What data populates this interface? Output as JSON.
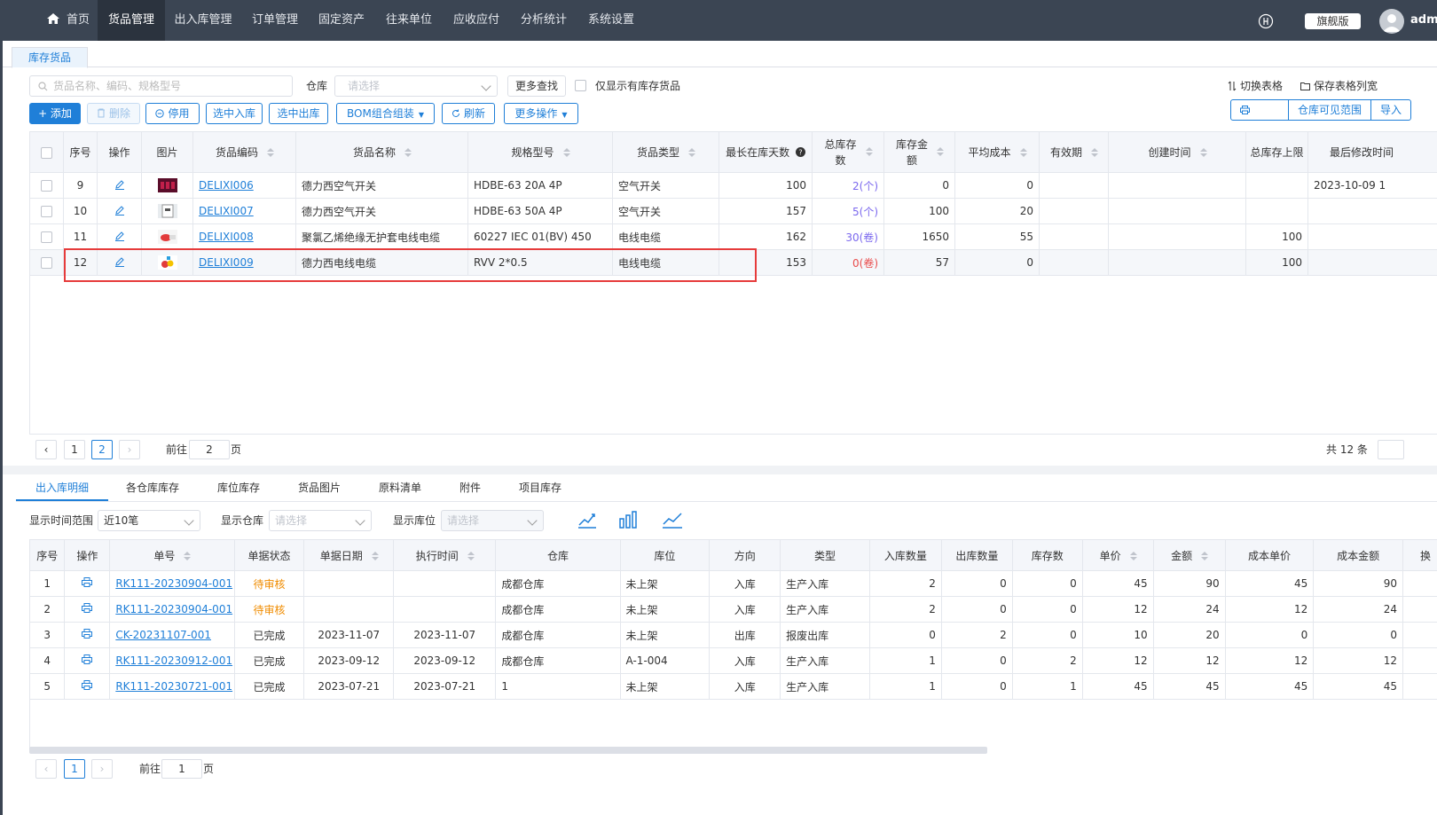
{
  "nav": {
    "items": [
      "首页",
      "货品管理",
      "出入库管理",
      "订单管理",
      "固定资产",
      "往来单位",
      "应收应付",
      "分析统计",
      "系统设置"
    ],
    "edition": "旗舰版",
    "user": "admi"
  },
  "page_tab": "库存货品",
  "toolbar": {
    "search_placeholder": "货品名称、编码、规格型号",
    "warehouse_label": "仓库",
    "warehouse_placeholder": "请选择",
    "more_search": "更多查找",
    "only_stock": "仅显示有库存货品",
    "switch_table": "切换表格",
    "save_columns": "保存表格列宽",
    "add": "+ 添加",
    "delete": "删除",
    "disable": "停用",
    "to_inbound": "选中入库",
    "to_outbound": "选中出库",
    "bom": "BOM组合组装",
    "refresh": "刷新",
    "more_ops": "更多操作",
    "print": "打印",
    "visible_range": "仓库可见范围",
    "import": "导入"
  },
  "goods_table": {
    "headers": [
      "序号",
      "操作",
      "图片",
      "货品编码",
      "货品名称",
      "规格型号",
      "货品类型",
      "最长在库天数",
      "总库存数",
      "库存金额",
      "平均成本",
      "有效期",
      "创建时间",
      "总库存上限",
      "最后修改时间"
    ],
    "header_wrap": {
      "total_stock": [
        "总库存",
        "数"
      ],
      "stock_amount": [
        "库存金",
        "额"
      ]
    },
    "rows": [
      {
        "no": "9",
        "code": "DELIXI006",
        "name": "德力西空气开关",
        "spec": "HDBE-63 20A 4P",
        "type": "空气开关",
        "days": "100",
        "stock": "2(个)",
        "amount": "0",
        "avg": "0",
        "expiry": "",
        "created": "",
        "limit": "",
        "modified": "2023-10-09 1"
      },
      {
        "no": "10",
        "code": "DELIXI007",
        "name": "德力西空气开关",
        "spec": "HDBE-63 50A 4P",
        "type": "空气开关",
        "days": "157",
        "stock": "5(个)",
        "amount": "100",
        "avg": "20",
        "expiry": "",
        "created": "",
        "limit": "",
        "modified": ""
      },
      {
        "no": "11",
        "code": "DELIXI008",
        "name": "聚氯乙烯绝缘无护套电线电缆",
        "spec": "60227 IEC 01(BV) 450",
        "type": "电线电缆",
        "days": "162",
        "stock": "30(卷)",
        "amount": "1650",
        "avg": "55",
        "expiry": "",
        "created": "",
        "limit": "100",
        "modified": ""
      },
      {
        "no": "12",
        "code": "DELIXI009",
        "name": "德力西电线电缆",
        "spec": "RVV 2*0.5",
        "type": "电线电缆",
        "days": "153",
        "stock": "0(卷)",
        "amount": "57",
        "avg": "0",
        "expiry": "",
        "created": "",
        "limit": "100",
        "modified": ""
      }
    ]
  },
  "pagination": {
    "pages": [
      "1",
      "2"
    ],
    "goto_label": "前往",
    "goto_value": "2",
    "page_unit": "页",
    "total": "共 12 条"
  },
  "bottom_tabs": [
    "出入库明细",
    "各仓库库存",
    "库位库存",
    "货品图片",
    "原料清单",
    "附件",
    "项目库存"
  ],
  "filters": {
    "time_label": "显示时间范围",
    "time_value": "近10笔",
    "wh_label": "显示仓库",
    "wh_placeholder": "请选择",
    "loc_label": "显示库位",
    "loc_placeholder": "请选择"
  },
  "detail_table": {
    "headers": [
      "序号",
      "操作",
      "单号",
      "单据状态",
      "单据日期",
      "执行时间",
      "仓库",
      "库位",
      "方向",
      "类型",
      "入库数量",
      "出库数量",
      "库存数",
      "单价",
      "金额",
      "成本单价",
      "成本金额",
      "换"
    ],
    "rows": [
      {
        "no": "1",
        "doc": "RK111-20230904-001",
        "status": "待审核",
        "date": "",
        "exec": "",
        "wh": "成都仓库",
        "loc": "未上架",
        "dir": "入库",
        "type": "生产入库",
        "in": "2",
        "out": "0",
        "stock": "0",
        "price": "45",
        "amount": "90",
        "cost_price": "45",
        "cost_amount": "90"
      },
      {
        "no": "2",
        "doc": "RK111-20230904-001",
        "status": "待审核",
        "date": "",
        "exec": "",
        "wh": "成都仓库",
        "loc": "未上架",
        "dir": "入库",
        "type": "生产入库",
        "in": "2",
        "out": "0",
        "stock": "0",
        "price": "12",
        "amount": "24",
        "cost_price": "12",
        "cost_amount": "24"
      },
      {
        "no": "3",
        "doc": "CK-20231107-001",
        "status": "已完成",
        "date": "2023-11-07",
        "exec": "2023-11-07",
        "wh": "成都仓库",
        "loc": "未上架",
        "dir": "出库",
        "type": "报废出库",
        "in": "0",
        "out": "2",
        "stock": "0",
        "price": "10",
        "amount": "20",
        "cost_price": "0",
        "cost_amount": "0"
      },
      {
        "no": "4",
        "doc": "RK111-20230912-001",
        "status": "已完成",
        "date": "2023-09-12",
        "exec": "2023-09-12",
        "wh": "成都仓库",
        "loc": "A-1-004",
        "dir": "入库",
        "type": "生产入库",
        "in": "1",
        "out": "0",
        "stock": "2",
        "price": "12",
        "amount": "12",
        "cost_price": "12",
        "cost_amount": "12"
      },
      {
        "no": "5",
        "doc": "RK111-20230721-001",
        "status": "已完成",
        "date": "2023-07-21",
        "exec": "2023-07-21",
        "wh": "1",
        "loc": "未上架",
        "dir": "入库",
        "type": "生产入库",
        "in": "1",
        "out": "0",
        "stock": "1",
        "price": "45",
        "amount": "45",
        "cost_price": "45",
        "cost_amount": "45"
      }
    ]
  },
  "bottom_pagination": {
    "page": "1",
    "goto_label": "前往",
    "goto_value": "1",
    "page_unit": "页"
  },
  "colors": {
    "nav_bg": "#3b4553",
    "accent": "#1f7fd8",
    "pending": "#f08c00",
    "zero_stock": "#e94b4b",
    "stock_link": "#7b68ee"
  }
}
